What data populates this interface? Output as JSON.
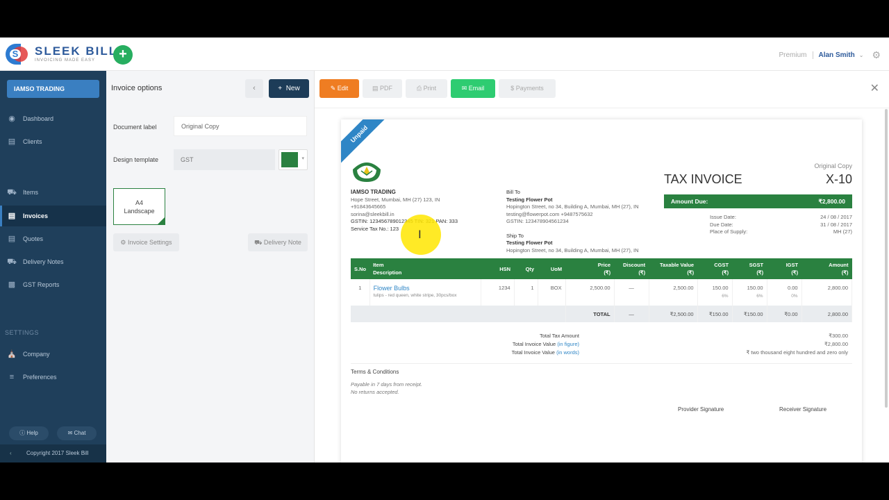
{
  "app": {
    "brand_name": "SLEEK BILL",
    "brand_tagline": "INVOICING MADE EASY",
    "add_label": "+",
    "plan": "Premium",
    "user": "Alan Smith"
  },
  "sidebar": {
    "company": "IAMSO TRADING",
    "items": [
      {
        "label": "Dashboard",
        "icon": "eye-icon"
      },
      {
        "label": "Clients",
        "icon": "clients-icon"
      },
      {
        "label": "Items",
        "icon": "truck-icon"
      },
      {
        "label": "Invoices",
        "icon": "invoice-icon",
        "active": true
      },
      {
        "label": "Quotes",
        "icon": "quote-icon"
      },
      {
        "label": "Delivery Notes",
        "icon": "truck-icon"
      },
      {
        "label": "GST Reports",
        "icon": "chart-icon"
      }
    ],
    "settings_heading": "SETTINGS",
    "settings_items": [
      {
        "label": "Company",
        "icon": "bank-icon"
      },
      {
        "label": "Preferences",
        "icon": "sliders-icon"
      }
    ],
    "help": "Help",
    "chat": "Chat",
    "copyright": "Copyright 2017 Sleek Bill"
  },
  "options": {
    "title": "Invoice options",
    "new_label": "New",
    "document_label_caption": "Document label",
    "document_label_value": "Original Copy",
    "design_template_caption": "Design template",
    "design_template_value": "GST",
    "accent_color": "#2a8140",
    "template_card_line1": "A4",
    "template_card_line2": "Landscape",
    "invoice_settings": "Invoice Settings",
    "delivery_note": "Delivery Note"
  },
  "toolbar": {
    "edit": "Edit",
    "pdf": "PDF",
    "print": "Print",
    "email": "Email",
    "payments": "Payments"
  },
  "invoice": {
    "status": "Unpaid",
    "copy_label": "Original Copy",
    "title": "TAX INVOICE",
    "number": "X-10",
    "seller": {
      "name": "IAMSO TRADING",
      "address": "Hope Street, Mumbai, MH (27) 123, IN",
      "phone": "+91843645665",
      "email": "sorina@sleekbill.in",
      "tax_line": "GSTIN: 123456789012345 TIN: 321 PAN: 333",
      "service_tax": "Service Tax No.: 123"
    },
    "bill_to": {
      "heading": "Bill To",
      "name": "Testing Flower Pot",
      "address": "Hopington Street, no 34, Building A, Mumbai, MH (27), IN",
      "contact": "testing@flowerpot.com +9487575632",
      "gstin": "GSTIN: 123478904561234"
    },
    "ship_to": {
      "heading": "Ship To",
      "name": "Testing Flower Pot",
      "address": "Hopington Street, no 34, Building A, Mumbai, MH (27), IN"
    },
    "amount_due_label": "Amount Due:",
    "amount_due": "₹2,800.00",
    "issue_date_label": "Issue Date:",
    "issue_date": "24 / 08 / 2017",
    "due_date_label": "Due Date:",
    "due_date": "31 / 08 / 2017",
    "supply_label": "Place of Supply:",
    "supply": "MH (27)",
    "table_headers": {
      "sno": "S.No",
      "item": "Item",
      "desc": "Description",
      "hsn": "HSN",
      "qty": "Qty",
      "uom": "UoM",
      "price": "Price",
      "discount": "Discount",
      "taxable": "Taxable Value",
      "cgst": "CGST",
      "sgst": "SGST",
      "igst": "IGST",
      "amount": "Amount",
      "rupee": "(₹)"
    },
    "items": [
      {
        "sno": "1",
        "name": "Flower Bulbs",
        "description": "tulips - red queen, white stripe, 30pcs/box",
        "hsn": "1234",
        "qty": "1",
        "uom": "BOX",
        "price": "2,500.00",
        "discount": "—",
        "taxable": "2,500.00",
        "cgst": "150.00",
        "cgst_pct": "6%",
        "sgst": "150.00",
        "sgst_pct": "6%",
        "igst": "0.00",
        "igst_pct": "0%",
        "amount": "2,800.00"
      }
    ],
    "totals": {
      "label": "TOTAL",
      "discount": "—",
      "taxable": "₹2,500.00",
      "cgst": "₹150.00",
      "sgst": "₹150.00",
      "igst": "₹0.00",
      "amount": "2,800.00"
    },
    "summary": {
      "tax_label": "Total Tax Amount",
      "tax_value": "₹300.00",
      "figure_label": "Total Invoice Value",
      "figure_suffix": "(in figure)",
      "figure_value": "₹2,800.00",
      "words_label": "Total Invoice Value",
      "words_suffix": "(in words)",
      "words_value": "₹ two thousand eight hundred and zero only"
    },
    "terms_heading": "Terms & Conditions",
    "terms_line1": "Payable in 7 days from receipt.",
    "terms_line2": "No returns accepted.",
    "provider_signature": "Provider Signature",
    "receiver_signature": "Receiver Signature"
  }
}
